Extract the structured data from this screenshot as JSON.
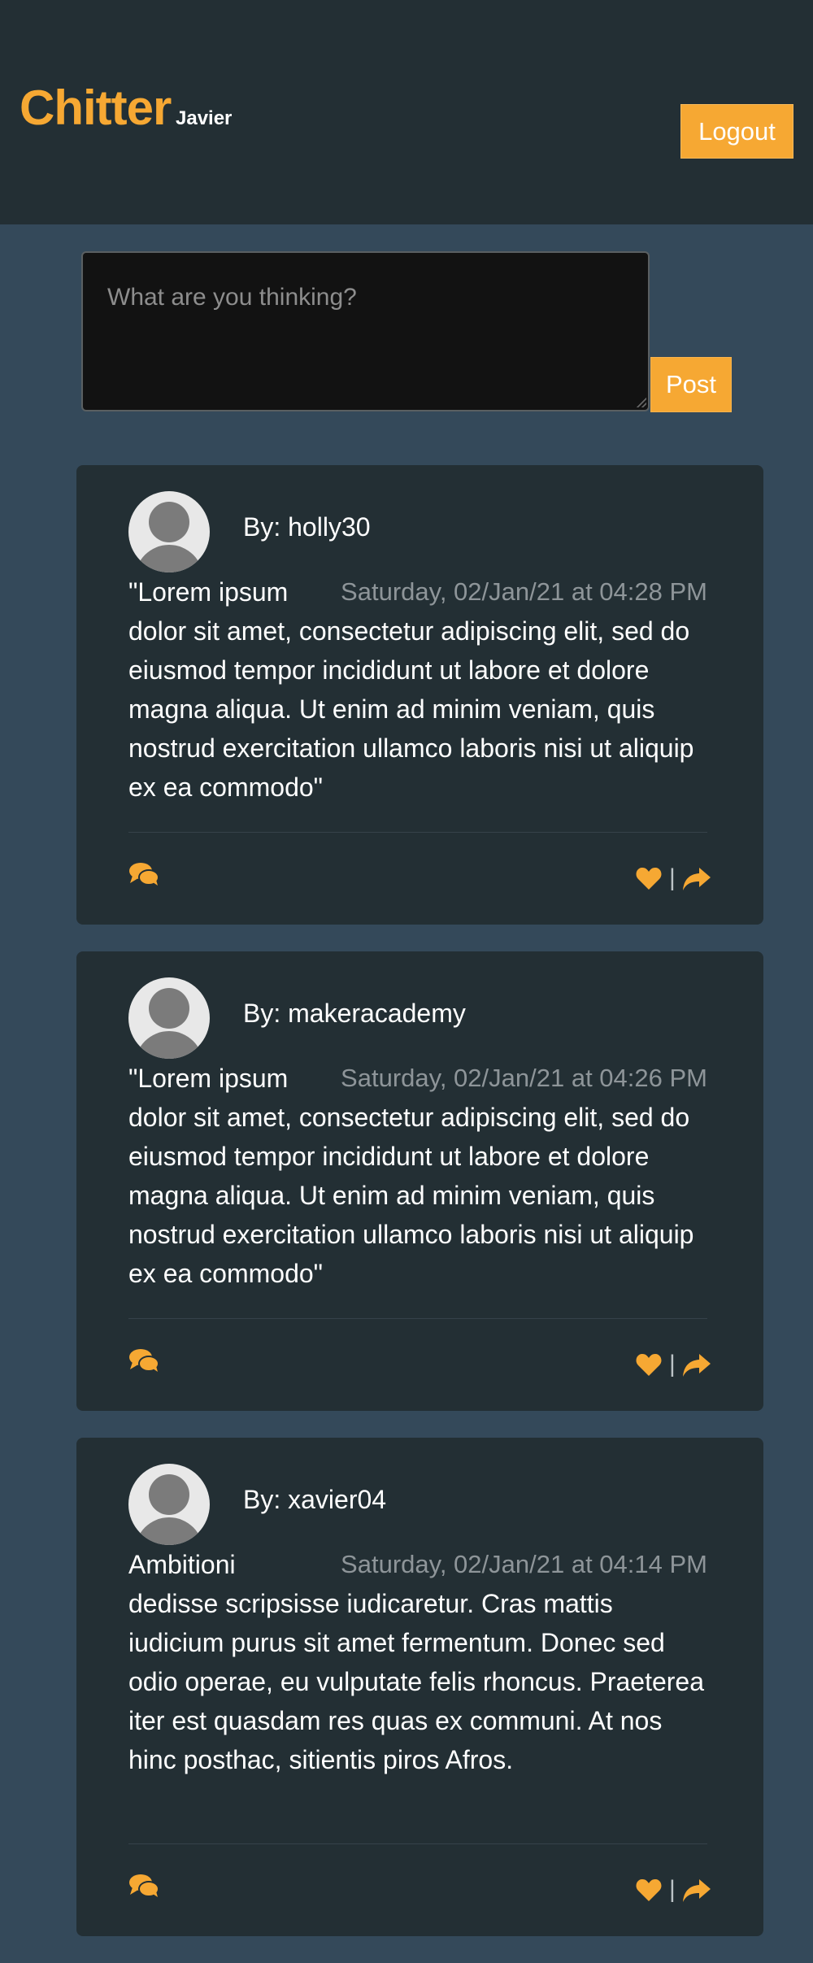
{
  "app": {
    "brand": "Chitter",
    "username": "Javier",
    "logout_label": "Logout"
  },
  "composer": {
    "placeholder": "What are you thinking?",
    "post_label": "Post"
  },
  "colors": {
    "accent": "#f6a833",
    "header_bg": "#232f34",
    "page_bg": "#34495a",
    "card_bg": "#232f34"
  },
  "posts": [
    {
      "author": "By: holly30",
      "date": "Saturday, 02/Jan/21 at 04:28 PM",
      "text": "\"Lorem ipsum dolor sit amet, consectetur adipiscing elit, sed do eiusmod tempor incididunt ut labore et dolore magna aliqua. Ut enim ad minim veniam, quis nostrud exercitation ullamco laboris nisi ut aliquip ex ea commodo\""
    },
    {
      "author": "By: makeracademy",
      "date": "Saturday, 02/Jan/21 at 04:26 PM",
      "text": "\"Lorem ipsum dolor sit amet, consectetur adipiscing elit, sed do eiusmod tempor incididunt ut labore et dolore magna aliqua. Ut enim ad minim veniam, quis nostrud exercitation ullamco laboris nisi ut aliquip ex ea commodo\""
    },
    {
      "author": "By: xavier04",
      "date": "Saturday, 02/Jan/21 at 04:14 PM",
      "text": "Ambitioni dedisse scripsisse iudicaretur. Cras mattis iudicium purus sit amet fermentum. Donec sed odio operae, eu vulputate felis rhoncus. Praeterea iter est quasdam res quas ex communi. At nos hinc posthac, sitientis piros Afros."
    }
  ],
  "actions": {
    "separator": "|",
    "comment_icon": "comments-icon",
    "like_icon": "heart-icon",
    "share_icon": "share-icon"
  }
}
